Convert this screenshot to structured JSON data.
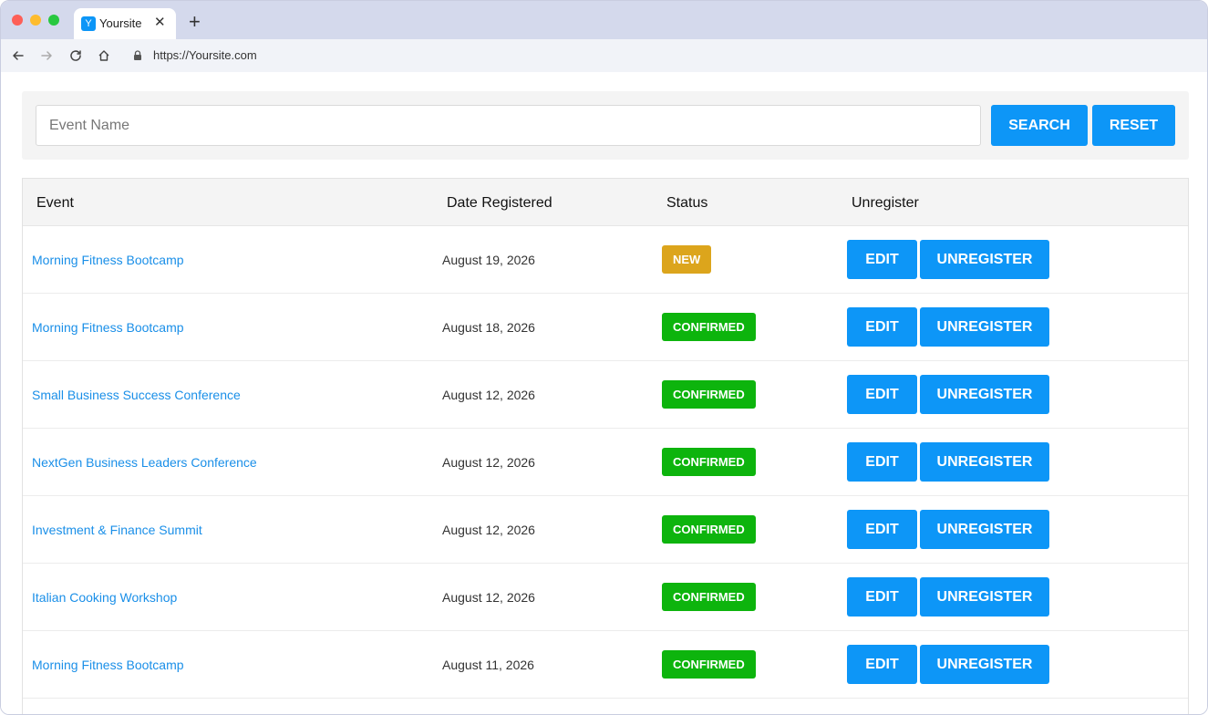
{
  "browser": {
    "tab_title": "Yoursite",
    "favicon_letter": "Y",
    "close_glyph": "✕",
    "new_tab_glyph": "+",
    "url": "https://Yoursite.com"
  },
  "search": {
    "placeholder": "Event Name",
    "search_label": "SEARCH",
    "reset_label": "RESET"
  },
  "table": {
    "headers": {
      "event": "Event",
      "date": "Date Registered",
      "status": "Status",
      "unregister": "Unregister"
    },
    "edit_label": "EDIT",
    "unregister_label": "UNREGISTER",
    "rows": [
      {
        "event": "Morning Fitness Bootcamp",
        "date": "August 19, 2026",
        "status": "NEW"
      },
      {
        "event": "Morning Fitness Bootcamp",
        "date": "August 18, 2026",
        "status": "CONFIRMED"
      },
      {
        "event": "Small Business Success Conference",
        "date": "August 12, 2026",
        "status": "CONFIRMED"
      },
      {
        "event": "NextGen Business Leaders Conference",
        "date": "August 12, 2026",
        "status": "CONFIRMED"
      },
      {
        "event": "Investment & Finance Summit",
        "date": "August 12, 2026",
        "status": "CONFIRMED"
      },
      {
        "event": "Italian Cooking Workshop",
        "date": "August 12, 2026",
        "status": "CONFIRMED"
      },
      {
        "event": "Morning Fitness Bootcamp",
        "date": "August 11, 2026",
        "status": "CONFIRMED"
      }
    ]
  },
  "colors": {
    "accent": "#0d96f7",
    "link": "#1a8fe8",
    "status_new": "#dca51c",
    "status_confirmed": "#0db40d"
  }
}
